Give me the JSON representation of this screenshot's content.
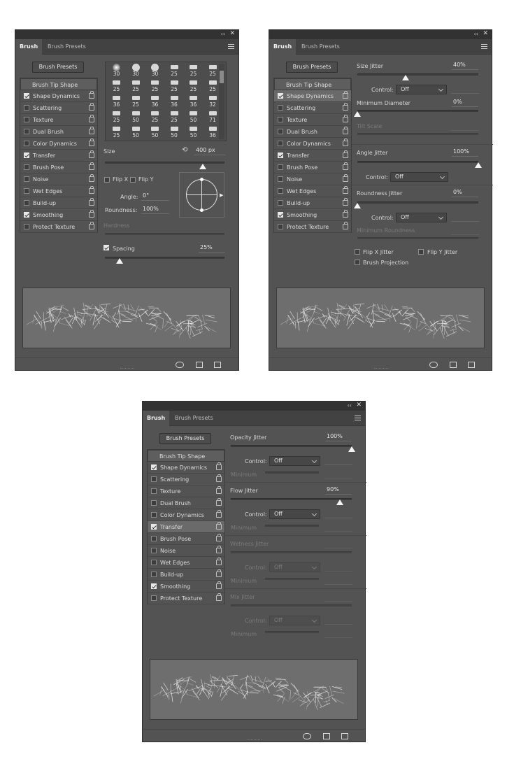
{
  "tabs": {
    "brush": "Brush",
    "presets": "Brush Presets"
  },
  "window": {
    "collapse": "‹‹",
    "close": "✕"
  },
  "presets_button": "Brush Presets",
  "tip_shape": "Brush Tip Shape",
  "list": [
    {
      "label": "Shape Dynamics",
      "checked": true
    },
    {
      "label": "Scattering",
      "checked": false
    },
    {
      "label": "Texture",
      "checked": false
    },
    {
      "label": "Dual Brush",
      "checked": false
    },
    {
      "label": "Color Dynamics",
      "checked": false
    },
    {
      "label": "Transfer",
      "checked": true
    },
    {
      "label": "Brush Pose",
      "checked": false
    },
    {
      "label": "Noise",
      "checked": false
    },
    {
      "label": "Wet Edges",
      "checked": false
    },
    {
      "label": "Build-up",
      "checked": false
    },
    {
      "label": "Smoothing",
      "checked": true
    },
    {
      "label": "Protect Texture",
      "checked": false
    }
  ],
  "panel1": {
    "brush_sizes": [
      "30",
      "30",
      "30",
      "25",
      "25",
      "25",
      "25",
      "25",
      "25",
      "25",
      "25",
      "25",
      "36",
      "25",
      "36",
      "36",
      "36",
      "32",
      "25",
      "50",
      "25",
      "25",
      "50",
      "71",
      "25",
      "50",
      "50",
      "50",
      "50",
      "36"
    ],
    "size_label": "Size",
    "size_value": "400 px",
    "size_level": 0.82,
    "flip_x": "Flip X",
    "flip_y": "Flip Y",
    "angle_label": "Angle:",
    "angle_value": "0°",
    "roundness_label": "Roundness:",
    "roundness_value": "100%",
    "hardness_label": "Hardness",
    "spacing_label": "Spacing",
    "spacing_value": "25%",
    "spacing_level": 0.12
  },
  "panel2": {
    "size_jitter": "Size Jitter",
    "size_jitter_value": "40%",
    "size_jitter_level": 0.4,
    "control": "Control:",
    "control_value": "Off",
    "min_diameter": "Minimum Diameter",
    "min_diameter_value": "0%",
    "tilt_scale": "Tilt Scale",
    "angle_jitter": "Angle Jitter",
    "angle_jitter_value": "100%",
    "angle_jitter_level": 1.0,
    "roundness_jitter": "Roundness Jitter",
    "roundness_jitter_value": "0%",
    "min_roundness": "Minimum Roundness",
    "flip_x_jitter": "Flip X Jitter",
    "flip_y_jitter": "Flip Y Jitter",
    "brush_projection": "Brush Projection"
  },
  "panel3": {
    "opacity_jitter": "Opacity Jitter",
    "opacity_jitter_value": "100%",
    "opacity_jitter_level": 1.0,
    "control": "Control:",
    "control_value": "Off",
    "minimum": "Minimum",
    "flow_jitter": "Flow Jitter",
    "flow_jitter_value": "90%",
    "flow_jitter_level": 0.9,
    "wetness_jitter": "Wetness Jitter",
    "mix_jitter": "Mix Jitter"
  },
  "colors": {
    "panel_bg": "#535353",
    "titlebar": "#323232",
    "preview_bg": "#6e6e6e"
  },
  "icons": [
    "toggle-preview-icon",
    "grid-icon",
    "new-brush-icon",
    "lock-icon",
    "panel-menu-icon"
  ]
}
